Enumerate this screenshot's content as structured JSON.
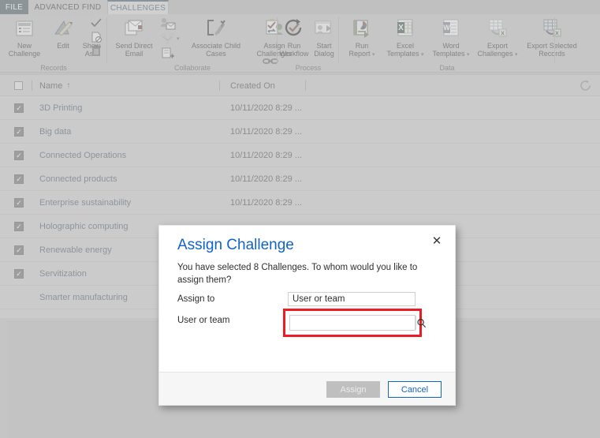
{
  "tabs": [
    {
      "label": "FILE",
      "name": "tab-file"
    },
    {
      "label": "ADVANCED FIND",
      "name": "tab-advanced-find"
    },
    {
      "label": "CHALLENGES",
      "name": "tab-challenges"
    }
  ],
  "ribbon": {
    "groups": [
      {
        "title": "Records",
        "items": [
          {
            "label": "New\nChallenge",
            "icon": "new-record-icon"
          },
          {
            "label": "Edit",
            "icon": "edit-pencil-ruler-icon"
          },
          {
            "label": "Show\nAs",
            "icon": "show-as-icon",
            "caret": true
          }
        ],
        "small_items": [
          {
            "icon": "check-icon"
          },
          {
            "icon": "deactivate-icon"
          },
          {
            "icon": "delete-trash-icon"
          }
        ]
      },
      {
        "title": "Collaborate",
        "items": [
          {
            "label": "Send Direct\nEmail",
            "icon": "send-direct-email-icon"
          },
          {
            "label": "Associate Child\nCases",
            "icon": "associate-child-cases-icon"
          },
          {
            "label": "Assign\nChallenges",
            "icon": "assign-challenges-icon"
          }
        ],
        "small_items": [
          {
            "icon": "add-connection-icon"
          },
          {
            "icon": "connections-icon",
            "caret": true
          },
          {
            "icon": "add-to-queue-icon"
          },
          {
            "icon": "link-icon"
          }
        ]
      },
      {
        "title": "Process",
        "items": [
          {
            "label": "Run\nWorkflow",
            "icon": "run-workflow-icon"
          },
          {
            "label": "Start\nDialog",
            "icon": "start-dialog-icon"
          }
        ],
        "small_items": []
      },
      {
        "title": "Data",
        "items": [
          {
            "label": "Run\nReport",
            "icon": "run-report-icon",
            "caret": true
          },
          {
            "label": "Excel\nTemplates",
            "icon": "excel-templates-icon",
            "caret": true
          },
          {
            "label": "Word\nTemplates",
            "icon": "word-templates-icon",
            "caret": true
          },
          {
            "label": "Export\nChallenges",
            "icon": "export-challenges-icon",
            "caret": true
          },
          {
            "label": "Export Selected\nRecords",
            "icon": "export-selected-records-icon"
          }
        ],
        "small_items": []
      }
    ]
  },
  "grid": {
    "columns": [
      {
        "label": "Name",
        "sort": "↑"
      },
      {
        "label": "Created On",
        "sort": ""
      }
    ],
    "refresh_icon": "refresh-icon",
    "rows": [
      {
        "checked": true,
        "name": "3D Printing",
        "created_on": "10/11/2020 8:29 ..."
      },
      {
        "checked": true,
        "name": "Big data",
        "created_on": "10/11/2020 8:29 ..."
      },
      {
        "checked": true,
        "name": "Connected Operations",
        "created_on": "10/11/2020 8:29 ..."
      },
      {
        "checked": true,
        "name": "Connected products",
        "created_on": "10/11/2020 8:29 ..."
      },
      {
        "checked": true,
        "name": "Enterprise sustainability",
        "created_on": "10/11/2020 8:29 ..."
      },
      {
        "checked": true,
        "name": "Holographic computing",
        "created_on": ""
      },
      {
        "checked": true,
        "name": "Renewable energy",
        "created_on": ""
      },
      {
        "checked": true,
        "name": "Servitization",
        "created_on": ""
      },
      {
        "checked": false,
        "name": "Smarter manufacturing",
        "created_on": ""
      }
    ]
  },
  "dialog": {
    "title": "Assign Challenge",
    "close_label": "✕",
    "description": "You have selected 8 Challenges. To whom would you like to assign them?",
    "fields": [
      {
        "label": "Assign to",
        "value": "User or team"
      },
      {
        "label": "User or team",
        "value": "",
        "placeholder": ""
      }
    ],
    "search_icon": "magnifier-icon",
    "buttons": {
      "assign": "Assign",
      "cancel": "Cancel"
    },
    "highlight_color": "#ed1c24"
  }
}
